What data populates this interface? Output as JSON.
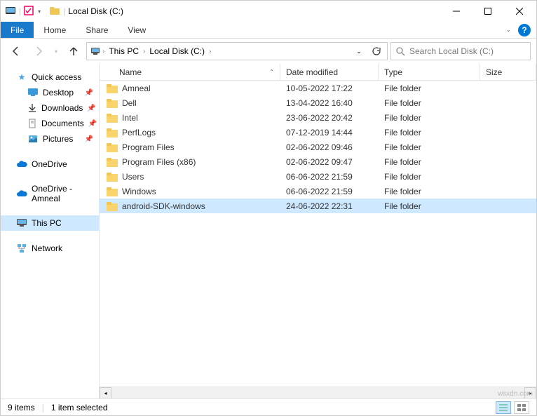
{
  "title": "Local Disk (C:)",
  "ribbon": {
    "file": "File",
    "home": "Home",
    "share": "Share",
    "view": "View"
  },
  "breadcrumb": [
    {
      "label": "This PC"
    },
    {
      "label": "Local Disk (C:)"
    }
  ],
  "search": {
    "placeholder": "Search Local Disk (C:)"
  },
  "sidebar": {
    "quickaccess": "Quick access",
    "desktop": "Desktop",
    "downloads": "Downloads",
    "documents": "Documents",
    "pictures": "Pictures",
    "onedrive": "OneDrive",
    "onedrive_amneal": "OneDrive - Amneal",
    "thispc": "This PC",
    "network": "Network"
  },
  "columns": {
    "name": "Name",
    "date": "Date modified",
    "type": "Type",
    "size": "Size"
  },
  "files": [
    {
      "name": "Amneal",
      "date": "10-05-2022 17:22",
      "type": "File folder",
      "selected": false
    },
    {
      "name": "Dell",
      "date": "13-04-2022 16:40",
      "type": "File folder",
      "selected": false
    },
    {
      "name": "Intel",
      "date": "23-06-2022 20:42",
      "type": "File folder",
      "selected": false
    },
    {
      "name": "PerfLogs",
      "date": "07-12-2019 14:44",
      "type": "File folder",
      "selected": false
    },
    {
      "name": "Program Files",
      "date": "02-06-2022 09:46",
      "type": "File folder",
      "selected": false
    },
    {
      "name": "Program Files (x86)",
      "date": "02-06-2022 09:47",
      "type": "File folder",
      "selected": false
    },
    {
      "name": "Users",
      "date": "06-06-2022 21:59",
      "type": "File folder",
      "selected": false
    },
    {
      "name": "Windows",
      "date": "06-06-2022 21:59",
      "type": "File folder",
      "selected": false
    },
    {
      "name": "android-SDK-windows",
      "date": "24-06-2022 22:31",
      "type": "File folder",
      "selected": true
    }
  ],
  "status": {
    "count": "9 items",
    "selected": "1 item selected"
  },
  "watermark": "wsxdn.com"
}
